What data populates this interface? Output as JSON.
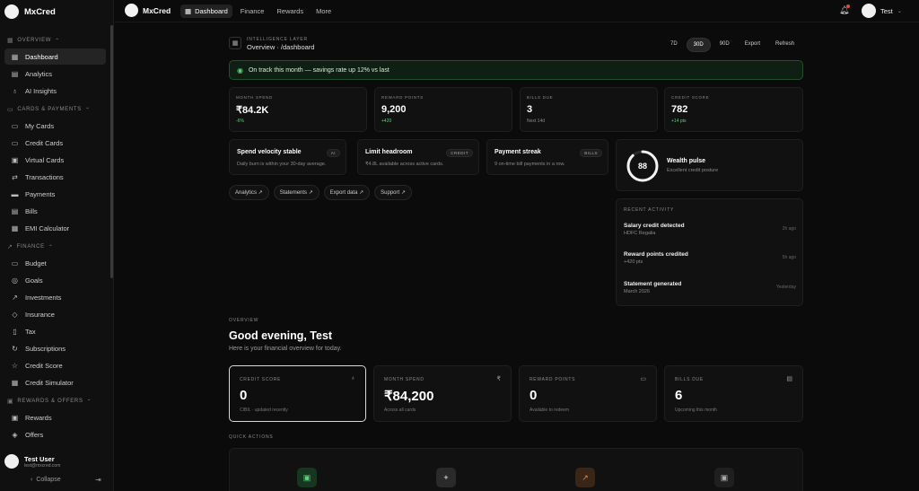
{
  "app": {
    "name": "MxCred"
  },
  "sidebar": {
    "sections": [
      {
        "label": "OVERVIEW",
        "items": [
          {
            "label": "Dashboard",
            "icon": "grid-icon",
            "active": true
          },
          {
            "label": "Analytics",
            "icon": "chart-icon"
          },
          {
            "label": "AI Insights",
            "icon": "bulb-icon"
          }
        ]
      },
      {
        "label": "CARDS & PAYMENTS",
        "items": [
          {
            "label": "My Cards",
            "icon": "card-icon"
          },
          {
            "label": "Credit Cards",
            "icon": "card-icon"
          },
          {
            "label": "Virtual Cards",
            "icon": "virtual-card-icon"
          },
          {
            "label": "Transactions",
            "icon": "transactions-icon"
          },
          {
            "label": "Payments",
            "icon": "payments-icon"
          },
          {
            "label": "Bills",
            "icon": "bills-icon"
          },
          {
            "label": "EMI Calculator",
            "icon": "calculator-icon"
          }
        ]
      },
      {
        "label": "FINANCE",
        "items": [
          {
            "label": "Budget",
            "icon": "wallet-icon"
          },
          {
            "label": "Goals",
            "icon": "target-icon"
          },
          {
            "label": "Investments",
            "icon": "trend-icon"
          },
          {
            "label": "Insurance",
            "icon": "shield-icon"
          },
          {
            "label": "Tax",
            "icon": "receipt-icon"
          },
          {
            "label": "Subscriptions",
            "icon": "refresh-icon"
          },
          {
            "label": "Credit Score",
            "icon": "star-icon"
          },
          {
            "label": "Credit Simulator",
            "icon": "simulator-icon"
          }
        ]
      },
      {
        "label": "REWARDS & OFFERS",
        "items": [
          {
            "label": "Rewards",
            "icon": "gift-icon"
          },
          {
            "label": "Offers",
            "icon": "tag-icon"
          }
        ]
      }
    ],
    "user": {
      "name": "Test User",
      "email": "test@mxcred.com"
    },
    "collapse_label": "Collapse"
  },
  "topbar": {
    "tabs": [
      {
        "label": "Dashboard",
        "active": true
      },
      {
        "label": "Finance"
      },
      {
        "label": "Rewards"
      },
      {
        "label": "More"
      }
    ],
    "user_name": "Test"
  },
  "header": {
    "eyebrow": "INTELLIGENCE LAYER",
    "breadcrumb": "Overview · /dashboard",
    "ranges": [
      "7D",
      "30D",
      "90D"
    ],
    "active_range": "30D",
    "export_label": "Export",
    "refresh_label": "Refresh"
  },
  "banner": {
    "text": "On track this month — savings rate up 12% vs last"
  },
  "stats": [
    {
      "label": "MONTH SPEND",
      "value": "₹84.2K",
      "sub": "-6%",
      "tone": "green"
    },
    {
      "label": "REWARD POINTS",
      "value": "9,200",
      "sub": "+420",
      "tone": "green"
    },
    {
      "label": "BILLS DUE",
      "value": "3",
      "sub": "Next 14d",
      "tone": "muted"
    },
    {
      "label": "CREDIT SCORE",
      "value": "782",
      "sub": "+14 pts",
      "tone": "green"
    }
  ],
  "insights": [
    {
      "title": "Spend velocity stable",
      "tag": "AI",
      "desc": "Daily burn is within your 30-day average."
    },
    {
      "title": "Limit headroom",
      "tag": "CREDIT",
      "desc": "₹4.8L available across active cards."
    },
    {
      "title": "Payment streak",
      "tag": "BILLS",
      "desc": "9 on-time bill payments in a row."
    }
  ],
  "quick_links": [
    "Analytics ↗",
    "Statements ↗",
    "Export data ↗",
    "Support ↗"
  ],
  "wealth_pulse": {
    "score": "88",
    "score_fraction": 0.88,
    "title": "Wealth pulse",
    "desc": "Excellent credit posture"
  },
  "recent_activity": {
    "title": "RECENT ACTIVITY",
    "items": [
      {
        "title": "Salary credit detected",
        "sub": "HDFC Regalia",
        "time": "2h ago"
      },
      {
        "title": "Reward points credited",
        "sub": "+420 pts",
        "time": "5h ago"
      },
      {
        "title": "Statement generated",
        "sub": "March 2026",
        "time": "Yesterday"
      }
    ]
  },
  "overview": {
    "eyebrow": "OVERVIEW",
    "greeting": "Good evening, Test",
    "subtitle": "Here is your financial overview for today."
  },
  "big_stats": [
    {
      "label": "CREDIT SCORE",
      "value": "0",
      "sub": "CIBIL · updated recently",
      "icon": "medal-icon"
    },
    {
      "label": "MONTH SPEND",
      "value": "₹84,200",
      "sub": "Across all cards",
      "icon": "rupee-icon"
    },
    {
      "label": "REWARD POINTS",
      "value": "0",
      "sub": "Available to redeem",
      "icon": "card-icon"
    },
    {
      "label": "BILLS DUE",
      "value": "6",
      "sub": "Upcoming this month",
      "icon": "bills-icon"
    }
  ],
  "quick_actions": {
    "title": "QUICK ACTIONS"
  },
  "colors": {
    "accent_green": "#5fd07a",
    "alert_red": "#e64a3b",
    "orange": "#e08a3c"
  }
}
